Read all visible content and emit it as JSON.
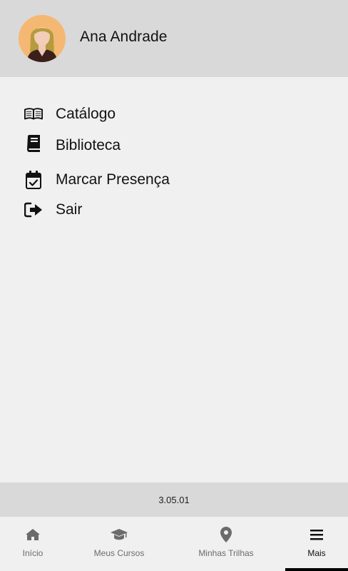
{
  "header": {
    "user_name": "Ana Andrade",
    "avatar_icon": "user-avatar"
  },
  "menu": {
    "items": [
      {
        "label": "Catálogo",
        "icon": "open-book-icon"
      },
      {
        "label": "Biblioteca",
        "icon": "book-icon"
      },
      {
        "label": "Marcar Presença",
        "icon": "calendar-check-icon"
      },
      {
        "label": "Sair",
        "icon": "sign-out-icon"
      }
    ]
  },
  "footer": {
    "version": "3.05.01"
  },
  "bottom_nav": {
    "items": [
      {
        "label": "Início",
        "icon": "home-icon",
        "active": false
      },
      {
        "label": "Meus Cursos",
        "icon": "graduation-cap-icon",
        "active": false
      },
      {
        "label": "Minhas Trilhas",
        "icon": "map-pin-icon",
        "active": false
      },
      {
        "label": "Mais",
        "icon": "menu-bars-icon",
        "active": true
      }
    ]
  },
  "colors": {
    "header_bg": "#d9d9d9",
    "body_bg": "#f0f0f0",
    "avatar_bg": "#f5b872",
    "active_indicator": "#000000",
    "inactive_nav": "#6b6b6b"
  }
}
